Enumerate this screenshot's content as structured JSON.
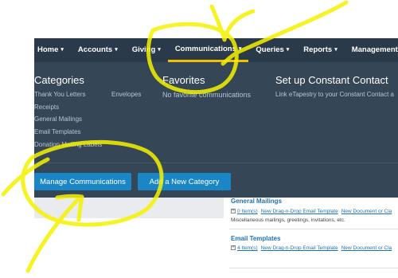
{
  "navbar": {
    "items": [
      {
        "label": "Home"
      },
      {
        "label": "Accounts"
      },
      {
        "label": "Giving"
      },
      {
        "label": "Communications"
      },
      {
        "label": "Queries"
      },
      {
        "label": "Reports"
      },
      {
        "label": "Management"
      }
    ],
    "active": "Communications",
    "caret": "▾"
  },
  "dropdown": {
    "categories": {
      "title": "Categories",
      "col1": [
        "Thank You Letters",
        "Receipts",
        "General Mailings",
        "Email Templates",
        "Donation Mailing Labels"
      ],
      "col2": [
        "Envelopes"
      ]
    },
    "favorites": {
      "title": "Favorites",
      "empty_text": "No favorite communications"
    },
    "setup": {
      "title": "Set up Constant Contact",
      "link": "Link eTapestry to your Constant Contact a"
    },
    "buttons": {
      "manage": "Manage Communications",
      "add": "Add a New Category"
    }
  },
  "content": {
    "sections": [
      {
        "title": "General Mailings",
        "plus": "+",
        "count": "0 Item(s)",
        "link1": "New Drag-n-Drop Email Template",
        "link2": "New Document or Cla",
        "description": "Miscellaneous mailings, greetings, invitations, etc."
      },
      {
        "title": "Email Templates",
        "plus": "+",
        "count": "4 Item(s)",
        "link1": "New Drag-n-Drop Email Template",
        "link2": "New Document or Cla",
        "description": ""
      }
    ]
  },
  "colors": {
    "navbar_bg": "#2b3a4a",
    "dropdown_bg": "#354656",
    "button_bg": "#1a86c6",
    "active_underline": "#f2c200",
    "highlighter": "#f5f200",
    "link_blue": "#1e73b5"
  }
}
